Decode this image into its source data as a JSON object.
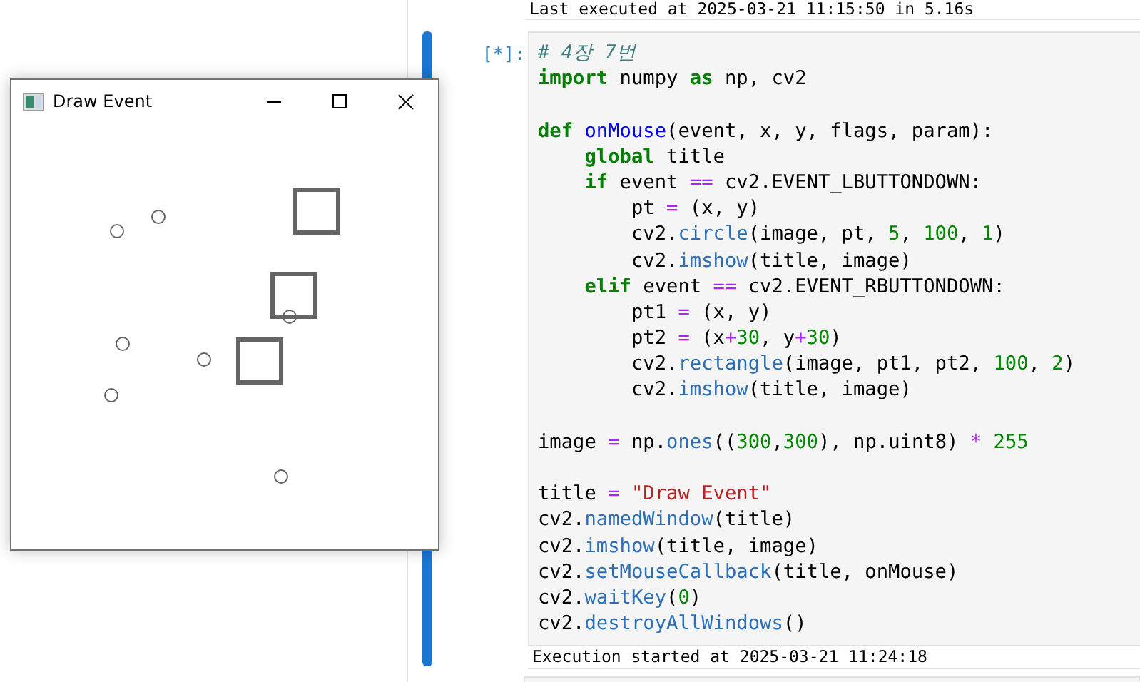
{
  "previous_output": {
    "text": "Last executed at 2025-03-21 11:15:50 in 5.16s"
  },
  "cell": {
    "prompt": "[*]:",
    "running": true,
    "blocks": [
      [
        [
          {
            "text": "# 4장 7번",
            "color": "#408080",
            "italic": true
          }
        ],
        [
          {
            "text": "import",
            "color": "#008000",
            "bold": true
          },
          {
            "text": " numpy ",
            "color": "#000000"
          },
          {
            "text": "as",
            "color": "#008000",
            "bold": true
          },
          {
            "text": " np, cv2",
            "color": "#000000"
          }
        ]
      ],
      [
        [
          {
            "text": "def",
            "color": "#008000",
            "bold": true
          },
          {
            "text": " onMouse",
            "color": "#0000ff"
          },
          {
            "text": "(event, x, y, flags, param):",
            "color": "#000000"
          }
        ],
        [
          {
            "text": "    global",
            "color": "#008000",
            "bold": true
          },
          {
            "text": " title",
            "color": "#000000"
          }
        ],
        [
          {
            "text": "    if",
            "color": "#008000",
            "bold": true
          },
          {
            "text": " event ",
            "color": "#000000"
          },
          {
            "text": "==",
            "color": "#aa22ff"
          },
          {
            "text": " cv2.EVENT_LBUTTONDOWN:",
            "color": "#000000"
          }
        ],
        [
          {
            "text": "        pt ",
            "color": "#000000"
          },
          {
            "text": "=",
            "color": "#aa22ff"
          },
          {
            "text": " (x, y)",
            "color": "#000000"
          }
        ],
        [
          {
            "text": "        cv2.",
            "color": "#000000"
          },
          {
            "text": "circle",
            "color": "#2a6fb8"
          },
          {
            "text": "(image, pt, ",
            "color": "#000000"
          },
          {
            "text": "5",
            "color": "#008800"
          },
          {
            "text": ", ",
            "color": "#000000"
          },
          {
            "text": "100",
            "color": "#008800"
          },
          {
            "text": ", ",
            "color": "#000000"
          },
          {
            "text": "1",
            "color": "#008800"
          },
          {
            "text": ")",
            "color": "#000000"
          }
        ],
        [
          {
            "text": "        cv2.",
            "color": "#000000"
          },
          {
            "text": "imshow",
            "color": "#2a6fb8"
          },
          {
            "text": "(title, image)",
            "color": "#000000"
          }
        ],
        [
          {
            "text": "    elif",
            "color": "#008000",
            "bold": true
          },
          {
            "text": " event ",
            "color": "#000000"
          },
          {
            "text": "==",
            "color": "#aa22ff"
          },
          {
            "text": " cv2.EVENT_RBUTTONDOWN:",
            "color": "#000000"
          }
        ],
        [
          {
            "text": "        pt1 ",
            "color": "#000000"
          },
          {
            "text": "=",
            "color": "#aa22ff"
          },
          {
            "text": " (x, y)",
            "color": "#000000"
          }
        ],
        [
          {
            "text": "        pt2 ",
            "color": "#000000"
          },
          {
            "text": "=",
            "color": "#aa22ff"
          },
          {
            "text": " (x",
            "color": "#000000"
          },
          {
            "text": "+",
            "color": "#aa22ff"
          },
          {
            "text": "30",
            "color": "#008800"
          },
          {
            "text": ", y",
            "color": "#000000"
          },
          {
            "text": "+",
            "color": "#aa22ff"
          },
          {
            "text": "30",
            "color": "#008800"
          },
          {
            "text": ")",
            "color": "#000000"
          }
        ],
        [
          {
            "text": "        cv2.",
            "color": "#000000"
          },
          {
            "text": "rectangle",
            "color": "#2a6fb8"
          },
          {
            "text": "(image, pt1, pt2, ",
            "color": "#000000"
          },
          {
            "text": "100",
            "color": "#008800"
          },
          {
            "text": ", ",
            "color": "#000000"
          },
          {
            "text": "2",
            "color": "#008800"
          },
          {
            "text": ")",
            "color": "#000000"
          }
        ],
        [
          {
            "text": "        cv2.",
            "color": "#000000"
          },
          {
            "text": "imshow",
            "color": "#2a6fb8"
          },
          {
            "text": "(title, image)",
            "color": "#000000"
          }
        ]
      ],
      [
        [
          {
            "text": "image ",
            "color": "#000000"
          },
          {
            "text": "=",
            "color": "#aa22ff"
          },
          {
            "text": " np.",
            "color": "#000000"
          },
          {
            "text": "ones",
            "color": "#2a6fb8"
          },
          {
            "text": "((",
            "color": "#000000"
          },
          {
            "text": "300",
            "color": "#008800"
          },
          {
            "text": ",",
            "color": "#000000"
          },
          {
            "text": "300",
            "color": "#008800"
          },
          {
            "text": "), np.uint8) ",
            "color": "#000000"
          },
          {
            "text": "*",
            "color": "#aa22ff"
          },
          {
            "text": " 255",
            "color": "#008800"
          }
        ]
      ],
      [
        [
          {
            "text": "title ",
            "color": "#000000"
          },
          {
            "text": "=",
            "color": "#aa22ff"
          },
          {
            "text": " \"Draw Event\"",
            "color": "#ba2121"
          }
        ],
        [
          {
            "text": "cv2.",
            "color": "#000000"
          },
          {
            "text": "namedWindow",
            "color": "#2a6fb8"
          },
          {
            "text": "(title)",
            "color": "#000000"
          }
        ],
        [
          {
            "text": "cv2.",
            "color": "#000000"
          },
          {
            "text": "imshow",
            "color": "#2a6fb8"
          },
          {
            "text": "(title, image)",
            "color": "#000000"
          }
        ],
        [
          {
            "text": "cv2.",
            "color": "#000000"
          },
          {
            "text": "setMouseCallback",
            "color": "#2a6fb8"
          },
          {
            "text": "(title, onMouse)",
            "color": "#000000"
          }
        ],
        [
          {
            "text": "cv2.",
            "color": "#000000"
          },
          {
            "text": "waitKey",
            "color": "#2a6fb8"
          },
          {
            "text": "(",
            "color": "#000000"
          },
          {
            "text": "0",
            "color": "#008800"
          },
          {
            "text": ")",
            "color": "#000000"
          }
        ],
        [
          {
            "text": "cv2.",
            "color": "#000000"
          },
          {
            "text": "destroyAllWindows",
            "color": "#2a6fb8"
          },
          {
            "text": "()",
            "color": "#000000"
          }
        ]
      ]
    ],
    "output": "Execution started at 2025-03-21 11:24:18"
  },
  "window": {
    "title": "Draw Event",
    "shapes": [
      {
        "kind": "circle"
      },
      {
        "kind": "circle"
      },
      {
        "kind": "circle"
      },
      {
        "kind": "circle"
      },
      {
        "kind": "circle"
      },
      {
        "kind": "circle"
      },
      {
        "kind": "circle"
      },
      {
        "kind": "square"
      },
      {
        "kind": "square"
      },
      {
        "kind": "square"
      }
    ]
  }
}
